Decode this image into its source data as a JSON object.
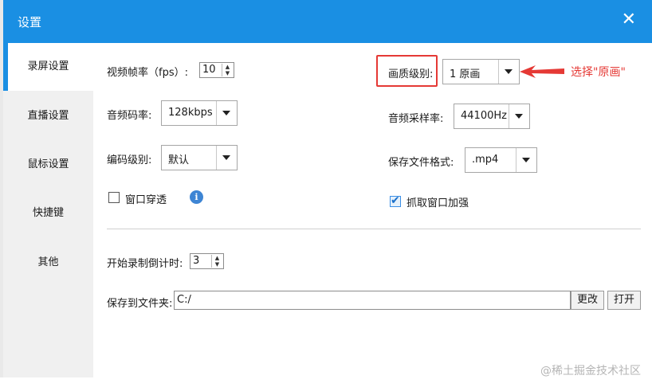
{
  "window": {
    "title": "设置",
    "close_glyph": "✕"
  },
  "sidebar": {
    "items": [
      {
        "label": "录屏设置",
        "active": true
      },
      {
        "label": "直播设置"
      },
      {
        "label": "鼠标设置"
      },
      {
        "label": "快捷键"
      },
      {
        "label": "其他"
      }
    ]
  },
  "settings": {
    "fps": {
      "label": "视频帧率（fps）:",
      "value": "10"
    },
    "quality": {
      "label": "画质级别:",
      "value": "1 原画"
    },
    "audio_bitrate": {
      "label": "音频码率:",
      "value": "128kbps"
    },
    "sample_rate": {
      "label": "音频采样率:",
      "value": "44100Hz"
    },
    "encoding_level": {
      "label": "编码级别:",
      "value": "默认"
    },
    "file_format": {
      "label": "保存文件格式:",
      "value": ".mp4"
    },
    "window_passthrough": {
      "label": "窗口穿透",
      "checked": false,
      "info_glyph": "i"
    },
    "capture_enhance": {
      "label": "抓取窗口加强",
      "checked": true,
      "check_glyph": "✔"
    },
    "countdown": {
      "label": "开始录制倒计时:",
      "value": "3"
    },
    "save_folder": {
      "label": "保存到文件夹:",
      "value": "C:/"
    },
    "change_button": "更改",
    "open_button": "打开"
  },
  "annotation": {
    "text": "选择\"原画\"",
    "color": "#e53935"
  },
  "watermark": "@稀土掘金技术社区",
  "colors": {
    "accent": "#1a8fe3",
    "sidebar_bg": "#f0f0f0"
  },
  "icons": {
    "spin_up": "▲",
    "spin_down": "▼"
  }
}
